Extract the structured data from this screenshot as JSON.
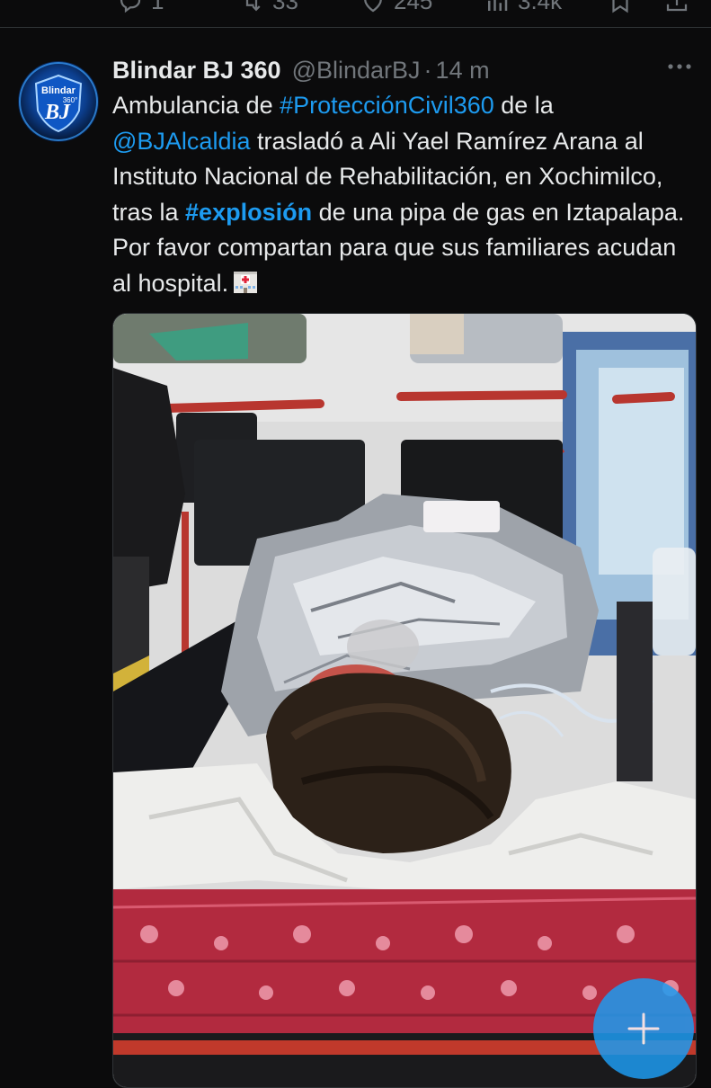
{
  "previous_tweet": {
    "reply_count": "1",
    "retweet_count": "33",
    "like_count": "245",
    "view_count": "3.4k"
  },
  "tweet": {
    "author_name": "Blindar BJ 360",
    "author_handle": "@BlindarBJ",
    "separator": "·",
    "timestamp": "14 m",
    "avatar_text": {
      "line1": "Blindar",
      "line2": "360°",
      "monogram": "BJ"
    },
    "text": {
      "part1": "Ambulancia de ",
      "hashtag1": "#ProtecciónCivil360",
      "part2": " de la ",
      "mention": "@BJAlcaldia",
      "part3": " trasladó a Ali Yael Ramírez Arana al Instituto Nacional de Rehabilitación, en Xochimilco, tras la ",
      "hashtag2": "#explosión",
      "part4": " de una pipa de gas en Iztapalapa. Por favor compartan para que sus familiares acudan al hospital."
    },
    "emoji": "hospital-emoji",
    "media": {
      "description_icon": "photo"
    }
  },
  "compose_button": {
    "icon": "plus-icon"
  },
  "colors": {
    "background": "#0b0b0c",
    "text": "#e7e9ea",
    "muted": "#71767b",
    "link": "#1d9bf0"
  }
}
